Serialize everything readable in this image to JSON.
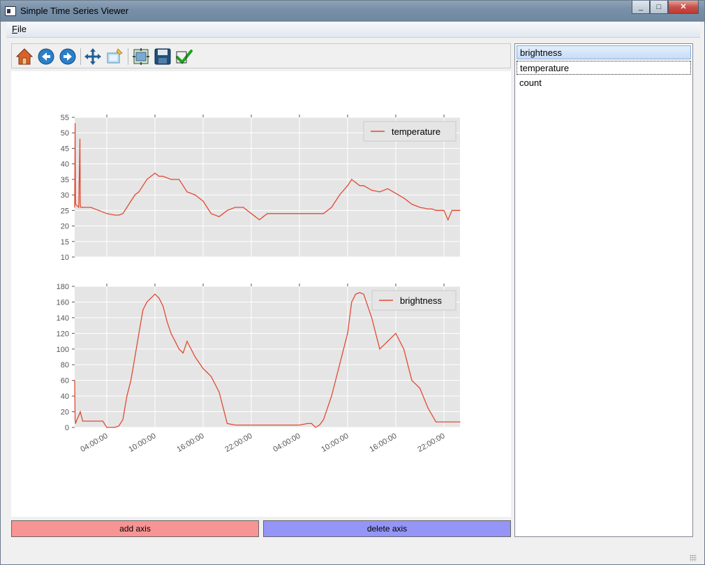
{
  "window": {
    "title": "Simple Time Series Viewer",
    "min_label": "_",
    "max_label": "□",
    "close_label": "✕"
  },
  "menu": {
    "file_label": "File",
    "file_mnemonic": "F",
    "file_rest": "ile"
  },
  "toolbar": {
    "items": [
      {
        "name": "home-icon"
      },
      {
        "name": "back-icon"
      },
      {
        "name": "forward-icon"
      },
      {
        "name": "pan-icon"
      },
      {
        "name": "zoom-icon"
      },
      {
        "name": "configure-subplots-icon"
      },
      {
        "name": "save-icon"
      },
      {
        "name": "apply-icon"
      }
    ]
  },
  "series_list": {
    "items": [
      {
        "label": "brightness",
        "selected": true
      },
      {
        "label": "temperature",
        "focused": true
      },
      {
        "label": "count"
      }
    ]
  },
  "buttons": {
    "add_axis": "add axis",
    "delete_axis": "delete axis"
  },
  "colors": {
    "line": "#e24a33",
    "plot_bg": "#e5e5e5",
    "add_button": "#f89494",
    "delete_button": "#9495f7"
  },
  "chart_data": [
    {
      "type": "line",
      "legend": [
        "temperature"
      ],
      "legend_position": "top-right",
      "grid": true,
      "ylim": [
        10,
        55
      ],
      "yticks": [
        10,
        15,
        20,
        25,
        30,
        35,
        40,
        45,
        50,
        55
      ],
      "xlim": [
        "00:00",
        "48:00"
      ],
      "x_hours": [
        0,
        0.05,
        0.1,
        0.3,
        0.5,
        0.65,
        0.7,
        0.75,
        1,
        2,
        3,
        4,
        5,
        5.5,
        6,
        6.5,
        7,
        7.5,
        8,
        8.5,
        9,
        9.5,
        10,
        10.5,
        11,
        12,
        13,
        13.5,
        14,
        15,
        16,
        17,
        18,
        19,
        20,
        20.5,
        21,
        22,
        23,
        23.5,
        24,
        25,
        26,
        27,
        28,
        29,
        30,
        31,
        32,
        33,
        34,
        34.5,
        35,
        35.5,
        36,
        37,
        38,
        39,
        40,
        41,
        42,
        43,
        44,
        44.5,
        45,
        46,
        46.5,
        47,
        48
      ],
      "series": [
        {
          "values": [
            26,
            53,
            27,
            26.5,
            26,
            48,
            27,
            26,
            26,
            26,
            25,
            24,
            23.5,
            23.5,
            24,
            26,
            28,
            30,
            31,
            33,
            35,
            36,
            37,
            36,
            36,
            35,
            35,
            33,
            31,
            30,
            28,
            24,
            23,
            25,
            26,
            26,
            26,
            24,
            22,
            23,
            24,
            24,
            24,
            24,
            24,
            24,
            24,
            24,
            26,
            30,
            33,
            35,
            34,
            33,
            33,
            31.5,
            31,
            32,
            30.5,
            29,
            27,
            26,
            25.5,
            25.5,
            25,
            25,
            22,
            25,
            25
          ]
        }
      ]
    },
    {
      "type": "line",
      "legend": [
        "brightness"
      ],
      "legend_position": "top-right",
      "grid": true,
      "ylim": [
        0,
        180
      ],
      "yticks": [
        0,
        20,
        40,
        60,
        80,
        100,
        120,
        140,
        160,
        180
      ],
      "xlim": [
        "00:00",
        "48:00"
      ],
      "xticks": [
        "04:00:00",
        "10:00:00",
        "16:00:00",
        "22:00:00",
        "04:00:00",
        "10:00:00",
        "16:00:00",
        "22:00:00"
      ],
      "x_hours": [
        0,
        0.05,
        0.1,
        0.2,
        0.5,
        0.7,
        1,
        2,
        3,
        3.5,
        4,
        5,
        5.5,
        6,
        6.5,
        7,
        7.5,
        8,
        8.5,
        9,
        9.5,
        10,
        10.5,
        11,
        11.5,
        12,
        12.5,
        13,
        13.5,
        14,
        15,
        16,
        16.5,
        17,
        18,
        19,
        20,
        20.5,
        21,
        22,
        23,
        24,
        25,
        26,
        27,
        28,
        29,
        29.5,
        30,
        30.5,
        31,
        32,
        33,
        34,
        34.5,
        35,
        35.5,
        36,
        37,
        38,
        39,
        40,
        41,
        42,
        43,
        44,
        45,
        46,
        47,
        48
      ],
      "series": [
        {
          "values": [
            60,
            10,
            5,
            8,
            15,
            20,
            8,
            8,
            8,
            8,
            0,
            0,
            2,
            10,
            40,
            60,
            90,
            120,
            150,
            160,
            165,
            170,
            165,
            155,
            135,
            120,
            110,
            100,
            95,
            110,
            90,
            75,
            70,
            65,
            45,
            5,
            3,
            3,
            3,
            3,
            3,
            3,
            3,
            3,
            3,
            3,
            5,
            5,
            0,
            3,
            10,
            40,
            80,
            120,
            160,
            170,
            172,
            170,
            140,
            100,
            110,
            120,
            100,
            60,
            50,
            25,
            7,
            7,
            7,
            7
          ]
        }
      ]
    }
  ]
}
